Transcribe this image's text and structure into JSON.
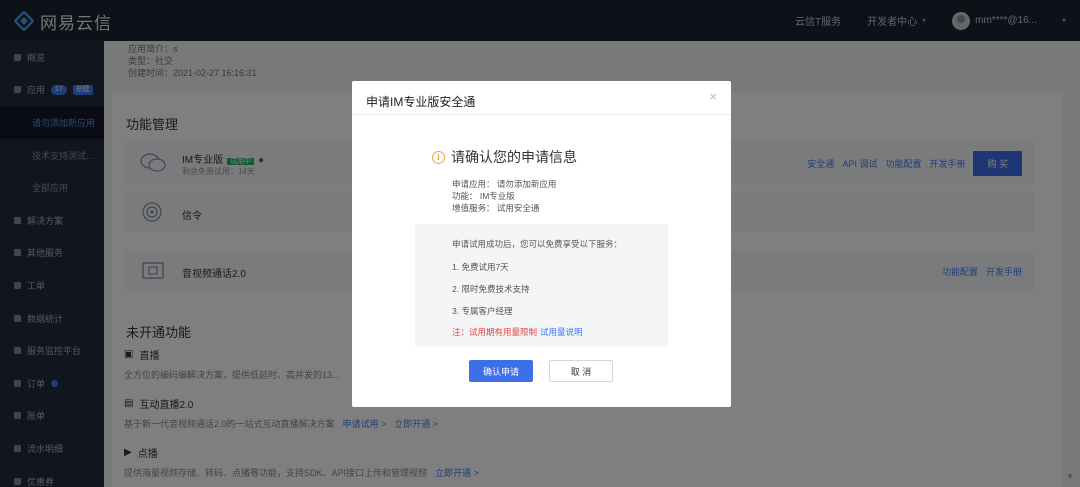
{
  "brand": {
    "name": "网易云信"
  },
  "topbar": {
    "items": [
      "云信T服务",
      "开发者中心"
    ],
    "user": "mm****@16..."
  },
  "sidebar": {
    "items": [
      {
        "label": "概览"
      },
      {
        "label": "应用",
        "badge": "17",
        "button": "创建"
      },
      {
        "label": "请勿添加新应用",
        "sub": true,
        "active": true
      },
      {
        "label": "技术支持测试...",
        "sub": true
      },
      {
        "label": "全部应用",
        "sub": true
      },
      {
        "label": "解决方案"
      },
      {
        "label": "其他服务"
      },
      {
        "label": "工单"
      },
      {
        "label": "数据统计"
      },
      {
        "label": "服务监控平台"
      },
      {
        "label": "订单"
      },
      {
        "label": "账单"
      },
      {
        "label": "流水明细"
      },
      {
        "label": "优惠券"
      }
    ]
  },
  "app_info": {
    "line1": "应用简介：s",
    "line2": "类型：社交",
    "line3": "创建时间：2021-02-27 16:16:31"
  },
  "main": {
    "section_active": "功能管理",
    "im_row": {
      "name": "IM专业版",
      "tag": "试用中",
      "remain": "剩余免费试用：14天",
      "links": [
        "安全通",
        "API 调试",
        "功能配置",
        "开发手册"
      ],
      "buy": "购 买"
    },
    "signal_row": {
      "name": "信令"
    },
    "av_row": {
      "name": "音视频通话2.0",
      "links": [
        "功能配置",
        "开发手册"
      ]
    },
    "section_inactive": "未开通功能",
    "features": [
      {
        "title": "直播",
        "desc": "全方位的编码编解决方案，提供低延时、高并发的13..."
      },
      {
        "title": "互动直播2.0",
        "desc": "基于新一代音视频通话2.0的一站式互动直播解决方案",
        "link1": "申请试用 >",
        "link2": "立即开通 >"
      },
      {
        "title": "点播",
        "desc": "提供海量视频存储、转码、点播等功能，支持SDK、API接口上传和管理视频",
        "link2": "立即开通 >"
      }
    ]
  },
  "modal": {
    "title": "申请IM专业版安全通",
    "close": "×",
    "heading": "请确认您的申请信息",
    "app_line": "申请应用：  请勿添加新应用",
    "feature_line": "功能：  IM专业版",
    "service_line": "增值服务：  试用安全通",
    "benefit_intro": "申请试用成功后，您可以免费享受以下服务：",
    "benefit_1": "1. 免费试用7天",
    "benefit_2": "2. 限时免费技术支持",
    "benefit_3": "3. 专属客户经理",
    "note": "注：试用期有用量限制",
    "note_link": "试用量说明",
    "confirm": "确认申请",
    "cancel": "取 消"
  },
  "colors": {
    "primary": "#3d6fe8",
    "topbar": "#1b2230",
    "sidebar": "#222b3a",
    "warning": "#f0a23a",
    "danger": "#e54545"
  }
}
